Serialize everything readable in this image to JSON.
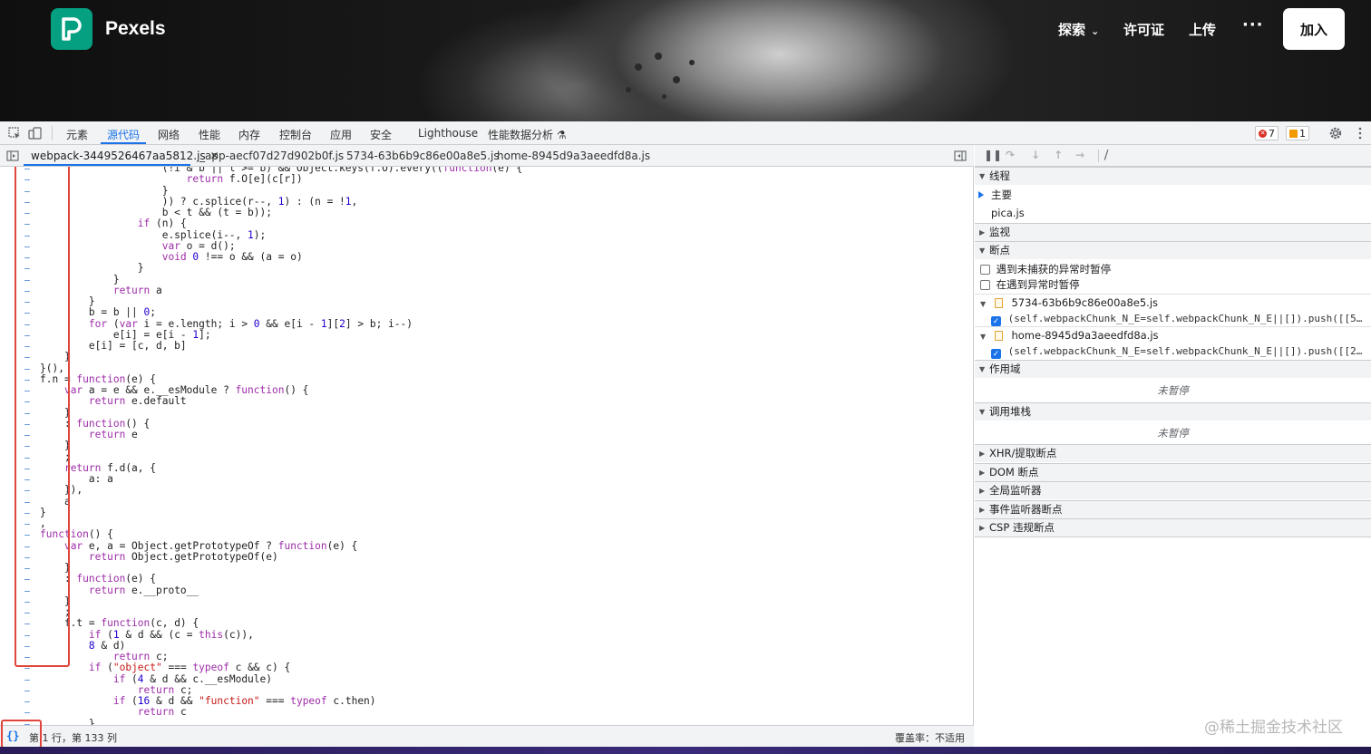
{
  "site": {
    "brand": "Pexels",
    "nav_explore": "探索",
    "nav_license": "许可证",
    "nav_upload": "上传",
    "nav_more": "···",
    "join": "加入"
  },
  "devtools": {
    "tabs": [
      "元素",
      "源代码",
      "网络",
      "性能",
      "内存",
      "控制台",
      "应用",
      "安全",
      "Lighthouse",
      "性能数据分析 ⚗"
    ],
    "active_tab": "源代码",
    "error_count": "7",
    "warning_count": "1"
  },
  "file_tabs": [
    "webpack-3449526467aa5812.js",
    "_app-aecf07d27d902b0f.js",
    "5734-63b6b9c86e00a8e5.js",
    "home-8945d9a3aeedfd8a.js"
  ],
  "code_lines": [
    "                    (!i & b || t >= b) && Object.keys(f.O).every((function(e) {",
    "                        return f.O[e](c[r])",
    "                    }",
    "                    )) ? c.splice(r--, 1) : (n = !1,",
    "                    b < t && (t = b));",
    "                if (n) {",
    "                    e.splice(i--, 1);",
    "                    var o = d();",
    "                    void 0 !== o && (a = o)",
    "                }",
    "            }",
    "            return a",
    "        }",
    "        b = b || 0;",
    "        for (var i = e.length; i > 0 && e[i - 1][2] > b; i--)",
    "            e[i] = e[i - 1];",
    "        e[i] = [c, d, b]",
    "    }",
    "}(),",
    "f.n = function(e) {",
    "    var a = e && e.__esModule ? function() {",
    "        return e.default",
    "    }",
    "    : function() {",
    "        return e",
    "    }",
    "    ;",
    "    return f.d(a, {",
    "        a: a",
    "    }),",
    "    a",
    "}",
    ",",
    "function() {",
    "    var e, a = Object.getPrototypeOf ? function(e) {",
    "        return Object.getPrototypeOf(e)",
    "    }",
    "    : function(e) {",
    "        return e.__proto__",
    "    }",
    "    ;",
    "    f.t = function(c, d) {",
    "        if (1 & d && (c = this(c)),",
    "        8 & d)",
    "            return c;",
    "        if (\"object\" === typeof c && c) {",
    "            if (4 & d && c.__esModule)",
    "                return c;",
    "            if (16 & d && \"function\" === typeof c.then)",
    "                return c",
    "        }"
  ],
  "status": {
    "pretty_print": "{}",
    "position": "第 1 行，第 133 列",
    "coverage": "覆盖率：不适用"
  },
  "debugger": {
    "threads_title": "线程",
    "thread_main": "主要",
    "thread_pica": "pica.js",
    "watch_title": "监视",
    "breakpoints_title": "断点",
    "pause_uncaught": "遇到未捕获的异常时暂停",
    "pause_caught": "在遇到异常时暂停",
    "bp_file1": "5734-63b6b9c86e00a8e5.js",
    "bp_code1": "(self.webpackChunk_N_E=self.webpackChunk_N_E||[]).push([[5…",
    "bp_file2": "home-8945d9a3aeedfd8a.js",
    "bp_code2": "(self.webpackChunk_N_E=self.webpackChunk_N_E||[]).push([[2…",
    "scope_title": "作用域",
    "scope_empty": "未暂停",
    "callstack_title": "调用堆栈",
    "callstack_empty": "未暂停",
    "xhr_title": "XHR/提取断点",
    "dom_title": "DOM 断点",
    "global_title": "全局监听器",
    "event_title": "事件监听器断点",
    "csp_title": "CSP 违规断点"
  },
  "watermark": "@稀土掘金技术社区"
}
